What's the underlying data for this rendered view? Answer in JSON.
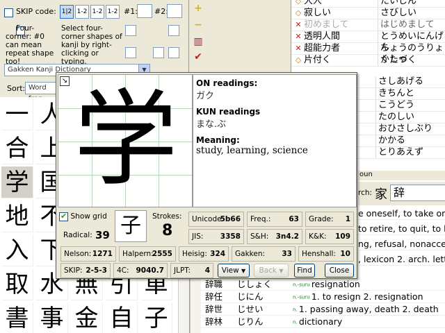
{
  "left_panel": {
    "skip_label": "SKIP code:",
    "skip_buttons": [
      "1|2",
      "1-2",
      "1-2",
      "1-2"
    ],
    "num1_label": "#1:",
    "num2_label": "#2:",
    "four_corner_label": "Four-corner: #0 can mean repeat shape too!",
    "four_corner_hint": "Select four-corner shapes of kanji by right-clicking or typing.",
    "dictionary": "Gakken Kanji Dictionary",
    "sort_label": "Sort:",
    "sort_value": "Word freq",
    "kanji_rows": [
      [
        "一",
        "人"
      ],
      [
        "合",
        "上"
      ],
      [
        "学",
        "国"
      ],
      [
        "地",
        "不"
      ],
      [
        "入",
        "下"
      ],
      [
        "取",
        "水",
        "無",
        "引",
        "車"
      ],
      [
        "書",
        "事",
        "金",
        "自",
        "子"
      ]
    ]
  },
  "right_list": {
    "rows": [
      {
        "mark": "◇",
        "word": "大人",
        "reading": "たいじん"
      },
      {
        "mark": "◇",
        "word": "寂しい",
        "reading": "さびしい"
      },
      {
        "mark": "✕",
        "word": "初めまして",
        "reading": "はじめまして",
        "faded": true
      },
      {
        "mark": "✕",
        "word": "透明人間",
        "reading": "とうめいにんげん"
      },
      {
        "mark": "✕",
        "word": "超能力者",
        "reading": "ちょうのうりょくしゃ"
      },
      {
        "mark": "◇",
        "word": "片付く",
        "reading": "かたづく"
      },
      {
        "mark": "",
        "word": "",
        "reading": "さしあげる"
      },
      {
        "mark": "",
        "word": "",
        "reading": "きちんと"
      },
      {
        "mark": "",
        "word": "",
        "reading": "こうどう"
      },
      {
        "mark": "",
        "word": "",
        "reading": "たのしい"
      },
      {
        "mark": "",
        "word": "",
        "reading": "おひさしぶり"
      },
      {
        "mark": "",
        "word": "",
        "reading": "かかる"
      },
      {
        "mark": "",
        "word": "",
        "reading": "とりあえず"
      }
    ]
  },
  "lower_panel": {
    "header": "oun",
    "search_label": "rch:",
    "search_kanji": "辞",
    "rows": [
      {
        "word": "",
        "reading": "",
        "def": "e oneself, to take on"
      },
      {
        "word": "",
        "reading": "",
        "def": "to retire, to quit, to leave"
      },
      {
        "word": "",
        "reading": "",
        "def": "ng, refusal, nonacceptance"
      },
      {
        "word": "",
        "reading": "",
        "def": ", lexicon  2. arch. letter"
      },
      {
        "word": "辞職",
        "reading": "じしょく",
        "tag": "n.-suru",
        "def": "resignation"
      },
      {
        "word": "辞任",
        "reading": "じにん",
        "tag": "n.-suru",
        "def": "1. to resign  2. resignation"
      },
      {
        "word": "辞世",
        "reading": "じせい",
        "tag": "n.",
        "def": "1. passing away, death  2. death"
      },
      {
        "word": "辞林",
        "reading": "じりん",
        "tag": "n.",
        "def": "dictionary"
      }
    ]
  },
  "popup": {
    "kanji": "学",
    "on_label": "ON readings:",
    "on_value": "ガク",
    "kun_label": "KUN readings",
    "kun_value": "まな.ぶ",
    "meaning_label": "Meaning:",
    "meaning_value": "study, learning, science",
    "show_grid_label": "Show grid",
    "radical_label": "Radical:",
    "radical_num": "39",
    "radical_char": "子",
    "strokes_label": "Strokes:",
    "strokes_value": "8",
    "unicode_label": "Unicode:",
    "unicode_value": "5b66",
    "freq_label": "Freq.:",
    "freq_value": "63",
    "grade_label": "Grade:",
    "grade_value": "1",
    "jis_label": "JIS:",
    "jis_value": "3358",
    "sh_label": "S&H:",
    "sh_value": "3n4.2",
    "kk_label": "K&K:",
    "kk_value": "109",
    "nelson_label": "Nelson:",
    "nelson_value": "1271",
    "halpern_label": "Halpern:",
    "halpern_value": "2555",
    "heisig_label": "Heisig:",
    "heisig_value": "324",
    "gakken_label": "Gakken:",
    "gakken_value": "33",
    "henshall_label": "Henshall:",
    "henshall_value": "10",
    "skip_label": "SKIP:",
    "skip_value": "2-5-3",
    "fourc_label": "4C:",
    "fourc_value": "9040.7",
    "jlpt_label": "JLPT:",
    "jlpt_value": "4",
    "view_button": "View",
    "back_button": "Back",
    "find_button": "Find",
    "close_button": "Close"
  }
}
